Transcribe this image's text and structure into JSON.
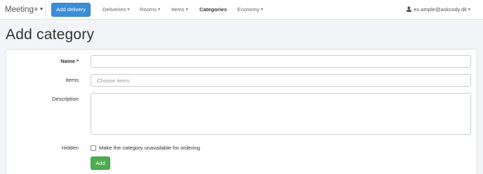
{
  "navbar": {
    "brand": "Meeting+",
    "add_delivery_label": "Add delivery",
    "items": [
      {
        "label": "Deliveries"
      },
      {
        "label": "Rooms"
      },
      {
        "label": "Items"
      },
      {
        "label": "Categories"
      },
      {
        "label": "Economy"
      }
    ],
    "active_item": "Categories",
    "user_email": "ex.ample@askcody.dk"
  },
  "page": {
    "title": "Add category"
  },
  "form": {
    "name_label": "Name *",
    "name_value": "",
    "items_label": "Items",
    "items_placeholder": "Choose items",
    "description_label": "Description",
    "description_value": "",
    "hidden_label": "Hidden",
    "hidden_checked": false,
    "hidden_checkbox_label": "Make the category unavailable for ordering",
    "submit_label": "Add"
  },
  "colors": {
    "primary": "#3b8ed5",
    "success": "#4cae4c",
    "background": "#f2f4f7"
  }
}
